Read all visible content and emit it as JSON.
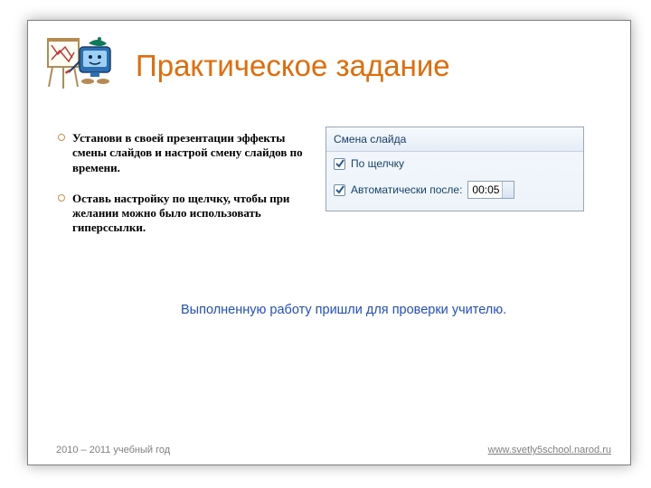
{
  "title": "Практическое задание",
  "bullets": [
    "Установи в своей презентации эффекты смены слайдов и настрой смену слайдов по времени.",
    "Оставь настройку по щелчку, чтобы при желании можно было использовать гиперссылки."
  ],
  "panel": {
    "header": "Смена слайда",
    "option1_label": "По щелчку",
    "option2_label": "Автоматически после:",
    "time_value": "00:05",
    "option1_checked": true,
    "option2_checked": true
  },
  "submit_note": "Выполненную работу пришли для проверки учителю.",
  "footer_left": "2010 – 2011 учебный год",
  "footer_right": "www.svetly5school.narod.ru"
}
